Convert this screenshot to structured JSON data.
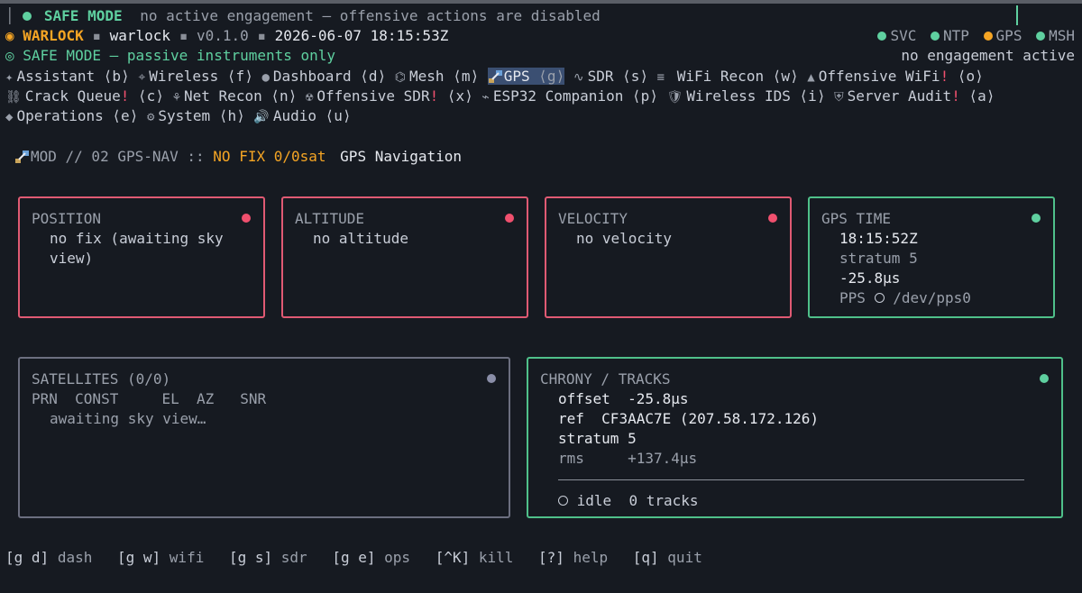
{
  "status": {
    "mode_label": "SAFE MODE",
    "mode_message": "no active engagement — offensive actions are disabled"
  },
  "header": {
    "brand": "WARLOCK",
    "host": "warlock",
    "version": "v0.1.0",
    "datetime": "2026-06-07 18:15:53Z",
    "subtitle": "SAFE MODE — passive instruments only",
    "indicators": [
      "SVC",
      "NTP",
      "GPS",
      "MSH"
    ],
    "engagement": "no engagement active"
  },
  "nav": {
    "row1": [
      {
        "icon": "✦",
        "label": "Assistant",
        "key": "⟨b⟩"
      },
      {
        "icon": "⌖",
        "label": "Wireless",
        "key": "⟨f⟩"
      },
      {
        "icon": "●",
        "label": "Dashboard",
        "key": "⟨d⟩"
      },
      {
        "icon": "⌬",
        "label": "Mesh",
        "key": "⟨m⟩"
      },
      {
        "icon": "",
        "label": "GPS",
        "key": "⟨g⟩"
      },
      {
        "icon": "∿",
        "label": "SDR",
        "key": "⟨s⟩"
      },
      {
        "icon": "≡",
        "label": "WiFi Recon",
        "key": "⟨w⟩"
      },
      {
        "icon": "▲",
        "label": "Offensive WiFi",
        "bang": "!",
        "key": "⟨o⟩"
      }
    ],
    "row2": [
      {
        "icon": "⛓",
        "label": "Crack Queue",
        "bang": "!",
        "key": "⟨c⟩"
      },
      {
        "icon": "⚘",
        "label": "Net Recon",
        "key": "⟨n⟩"
      },
      {
        "icon": "☢",
        "label": "Offensive SDR",
        "bang": "!",
        "key": "⟨x⟩"
      },
      {
        "icon": "⌁",
        "label": "ESP32 Companion",
        "key": "⟨p⟩"
      },
      {
        "icon": "🛡",
        "label": "Wireless IDS",
        "key": "⟨i⟩"
      },
      {
        "icon": "⛨",
        "label": "Server Audit",
        "bang": "!",
        "key": "⟨a⟩"
      }
    ],
    "row3": [
      {
        "icon": "◆",
        "label": "Operations",
        "key": "⟨e⟩"
      },
      {
        "icon": "⚙",
        "label": "System",
        "key": "⟨h⟩"
      },
      {
        "icon": "🔊",
        "label": "Audio",
        "key": "⟨u⟩"
      }
    ]
  },
  "module": {
    "prefix": "MOD // 02 GPS-NAV ::",
    "fix": "NO FIX 0/0sat",
    "title": "GPS Navigation"
  },
  "panels": {
    "position": {
      "title": "POSITION",
      "body": "no fix (awaiting sky view)"
    },
    "altitude": {
      "title": "ALTITUDE",
      "body": "no altitude"
    },
    "velocity": {
      "title": "VELOCITY",
      "body": "no velocity"
    },
    "gpstime": {
      "title": "GPS TIME",
      "time": "18:15:52Z",
      "stratum": "stratum 5",
      "offset": "-25.8µs",
      "pps_label": "PPS",
      "pps_dev": "/dev/pps0"
    },
    "satellites": {
      "title": "SATELLITES (0/0)",
      "columns": "PRN  CONST     EL  AZ   SNR",
      "body": "awaiting sky view…"
    },
    "chrony": {
      "title": "CHRONY / TRACKS",
      "offset_label": "offset",
      "offset": "-25.8µs",
      "ref_label": "ref",
      "ref": "CF3AAC7E (207.58.172.126)",
      "stratum": "stratum 5",
      "rms_label": "rms",
      "rms": "+137.4µs",
      "state": "idle",
      "tracks": "0 tracks"
    }
  },
  "footer": [
    {
      "key": "[g d]",
      "label": "dash"
    },
    {
      "key": "[g w]",
      "label": "wifi"
    },
    {
      "key": "[g s]",
      "label": "sdr"
    },
    {
      "key": "[g e]",
      "label": "ops"
    },
    {
      "key": "[^K]",
      "label": "kill"
    },
    {
      "key": "[?]",
      "label": "help"
    },
    {
      "key": "[q]",
      "label": "quit"
    }
  ]
}
